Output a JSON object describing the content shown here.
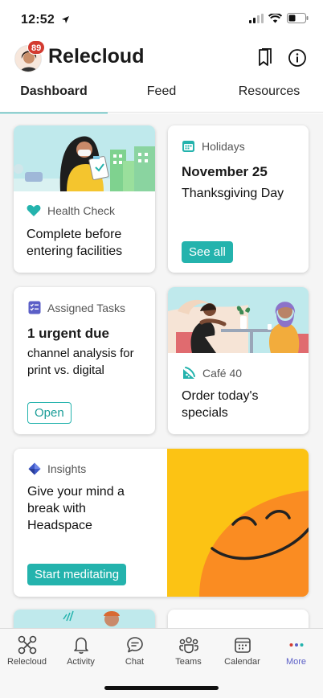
{
  "status": {
    "time": "12:52"
  },
  "header": {
    "title": "Relecloud",
    "badge_count": "89"
  },
  "tabs": [
    {
      "label": "Dashboard",
      "active": true
    },
    {
      "label": "Feed",
      "active": false
    },
    {
      "label": "Resources",
      "active": false
    }
  ],
  "cards": {
    "health": {
      "category": "Health Check",
      "text": "Complete before entering facilities",
      "icon": "heart-icon"
    },
    "holidays": {
      "category": "Holidays",
      "date": "November 25",
      "name": "Thanksgiving Day",
      "button": "See all",
      "icon": "calendar-icon"
    },
    "tasks": {
      "category": "Assigned Tasks",
      "headline": "1 urgent due",
      "text": "channel analysis for print vs. digital",
      "button": "Open",
      "icon": "checklist-icon"
    },
    "cafe": {
      "category": "Café 40",
      "text": "Order today's specials",
      "icon": "cafe-icon"
    },
    "insights": {
      "category": "Insights",
      "text": "Give your mind a break with Headspace",
      "button": "Start meditating",
      "icon": "diamond-icon"
    }
  },
  "bottom_nav": [
    {
      "label": "Relecloud",
      "icon": "relecloud-icon",
      "active": false
    },
    {
      "label": "Activity",
      "icon": "bell-icon",
      "active": false
    },
    {
      "label": "Chat",
      "icon": "chat-icon",
      "active": false
    },
    {
      "label": "Teams",
      "icon": "teams-icon",
      "active": false
    },
    {
      "label": "Calendar",
      "icon": "calendar-icon",
      "active": false
    },
    {
      "label": "More",
      "icon": "more-icon",
      "active": true
    }
  ],
  "colors": {
    "accent": "#24b3ad",
    "badge": "#d33b30",
    "nav_active": "#5b5fc7"
  }
}
